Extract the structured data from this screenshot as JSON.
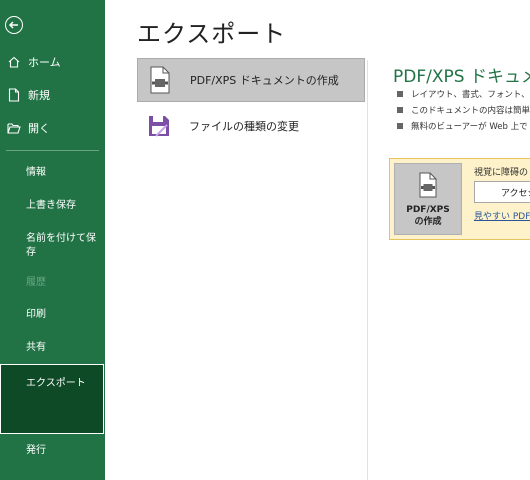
{
  "sidebar": {
    "nav": [
      {
        "label": "ホーム",
        "icon": "home-icon"
      },
      {
        "label": "新規",
        "icon": "new-document-icon"
      },
      {
        "label": "開く",
        "icon": "open-folder-icon"
      }
    ],
    "items": [
      {
        "label": "情報"
      },
      {
        "label": "上書き保存"
      },
      {
        "label": "名前を付けて保存"
      },
      {
        "label": "履歴",
        "disabled": true
      },
      {
        "label": "印刷"
      },
      {
        "label": "共有"
      },
      {
        "label": "エクスポート",
        "selected": true
      },
      {
        "label": "発行"
      }
    ]
  },
  "main": {
    "title": "エクスポート",
    "options": [
      {
        "label": "PDF/XPS ドキュメントの作成",
        "icon": "pdf-document-icon",
        "selected": true
      },
      {
        "label": "ファイルの種類の変更",
        "icon": "change-file-type-icon"
      }
    ],
    "detail": {
      "title": "PDF/XPS ドキュメン",
      "bullets": [
        "レイアウト、書式、フォント、画像",
        "このドキュメントの内容は簡単に",
        "無料のビューアーが Web 上で"
      ],
      "create_button_line1": "PDF/XPS",
      "create_button_line2": "の作成",
      "accessibility_heading": "視覚に障碍の",
      "accessibility_button": "アクセシ",
      "accessibility_link": "見やすい PDF"
    }
  },
  "colors": {
    "sidebar": "#217346",
    "selected_sidebar": "#0d4a25",
    "accent": "#217346",
    "callout": "#fdf2c9"
  }
}
